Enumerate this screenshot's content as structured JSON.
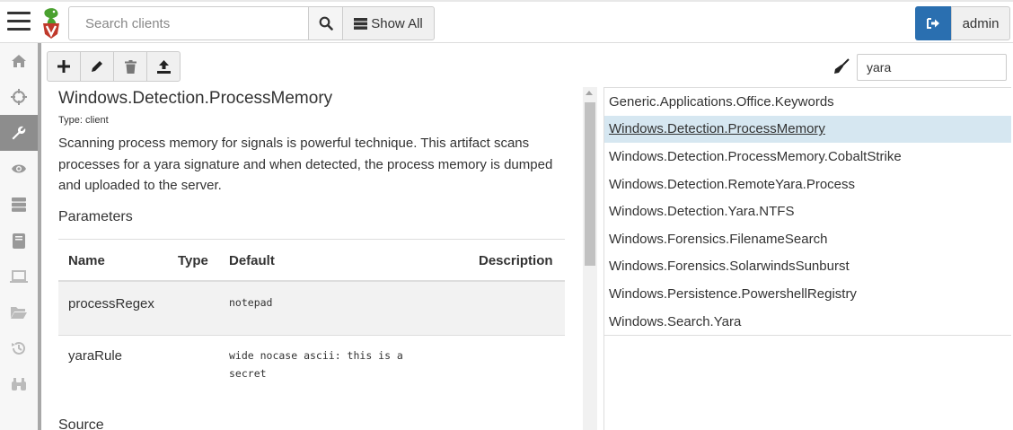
{
  "header": {
    "search_placeholder": "Search clients",
    "search_button_icon": "search-icon",
    "show_all_label": "Show All",
    "logout_icon": "sign-out-icon",
    "user_label": "admin",
    "accent_color": "#2a6fb0"
  },
  "sidebar": {
    "items": [
      {
        "icon": "home-icon"
      },
      {
        "icon": "crosshairs-icon"
      },
      {
        "icon": "wrench-icon",
        "active": true
      },
      {
        "icon": "eye-icon"
      },
      {
        "icon": "server-icon"
      },
      {
        "icon": "book-icon"
      },
      {
        "icon": "laptop-icon"
      },
      {
        "icon": "folder-open-icon"
      },
      {
        "icon": "history-icon"
      },
      {
        "icon": "binoculars-icon"
      }
    ]
  },
  "toolbar": {
    "buttons": [
      {
        "icon": "plus-icon"
      },
      {
        "icon": "pencil-icon"
      },
      {
        "icon": "trash-icon"
      },
      {
        "icon": "upload-icon"
      }
    ]
  },
  "filter": {
    "icon": "broom-icon",
    "value": "yara"
  },
  "artifact": {
    "title": "Windows.Detection.ProcessMemory",
    "type_label": "Type: client",
    "description": "Scanning process memory for signals is powerful technique. This artifact scans processes for a yara signature and when detected, the process memory is dumped and uploaded to the server.",
    "parameters_heading": "Parameters",
    "columns": {
      "name": "Name",
      "type": "Type",
      "default": "Default",
      "description": "Description"
    },
    "parameters": [
      {
        "name": "processRegex",
        "type": "",
        "default": "notepad",
        "description": ""
      },
      {
        "name": "yaraRule",
        "type": "",
        "default": "wide nocase ascii: this is a secret",
        "description": ""
      }
    ],
    "source_heading": "Source"
  },
  "results": {
    "items": [
      "Generic.Applications.Office.Keywords",
      "Windows.Detection.ProcessMemory",
      "Windows.Detection.ProcessMemory.CobaltStrike",
      "Windows.Detection.RemoteYara.Process",
      "Windows.Detection.Yara.NTFS",
      "Windows.Forensics.FilenameSearch",
      "Windows.Forensics.SolarwindsSunburst",
      "Windows.Persistence.PowershellRegistry",
      "Windows.Search.Yara"
    ],
    "selected": "Windows.Detection.ProcessMemory",
    "selected_color": "#d6e7f1"
  }
}
